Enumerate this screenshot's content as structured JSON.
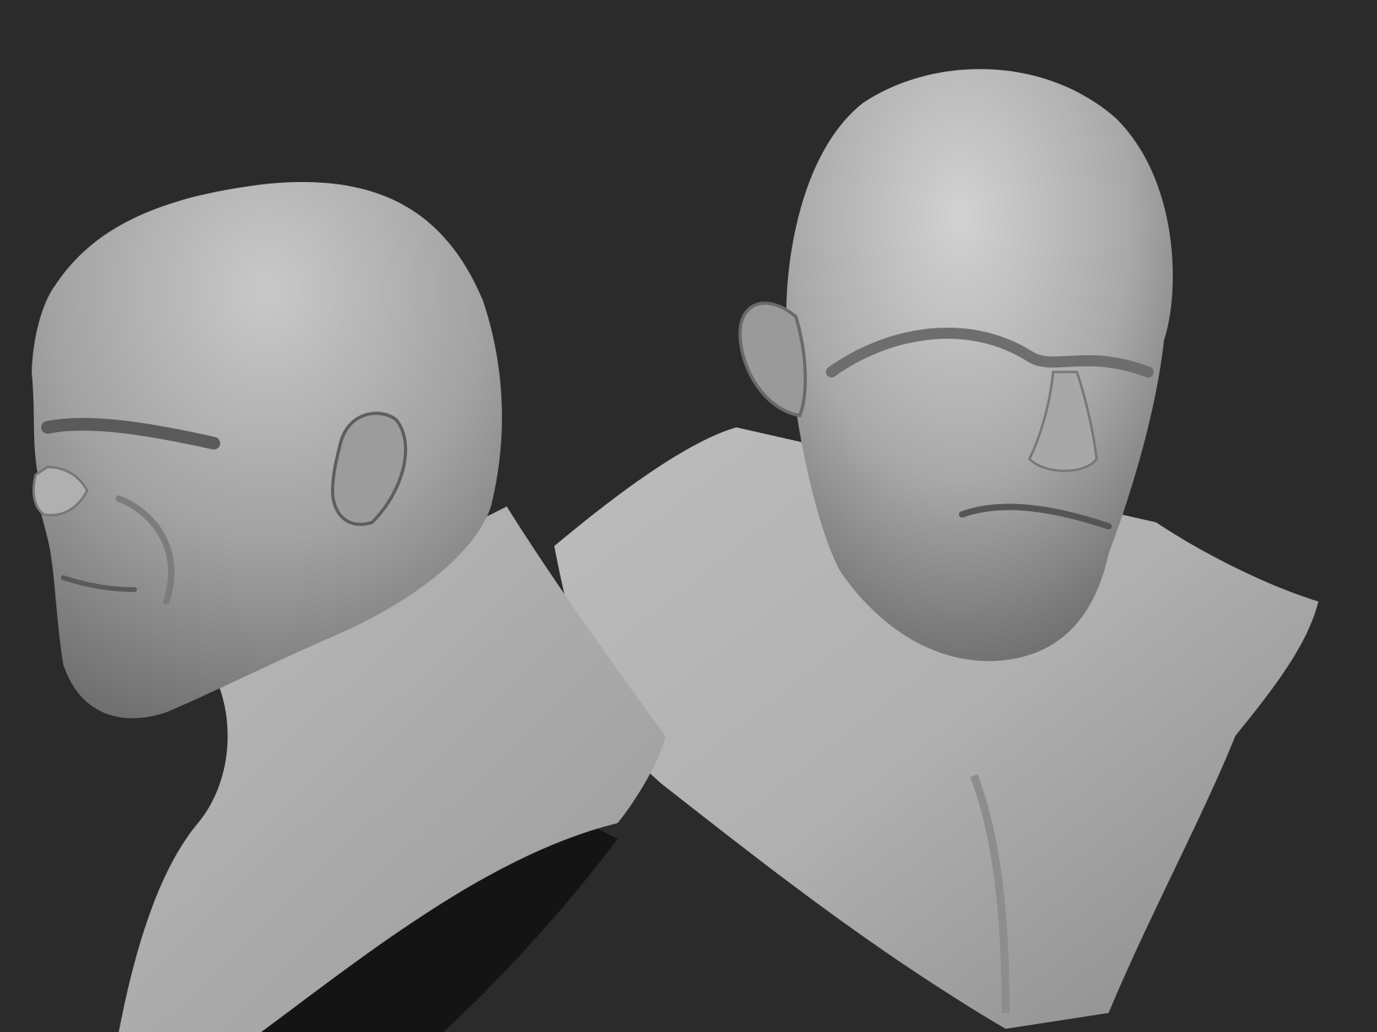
{
  "scene": {
    "background_color": "#2b2b2b",
    "material_light": "#cfcfcf",
    "material_mid": "#a4a4a4",
    "material_dark": "#5c5c5c",
    "shadow_color": "#141414",
    "models": [
      {
        "view": "profile-left",
        "subject": "bald-male-bust"
      },
      {
        "view": "three-quarter-front",
        "subject": "bald-male-bust"
      }
    ]
  }
}
